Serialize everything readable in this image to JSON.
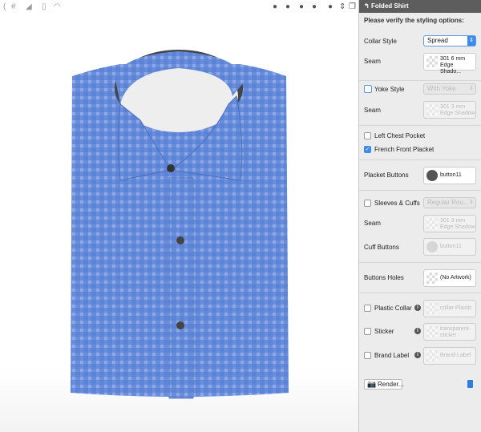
{
  "toolbar": {
    "left_icons": [
      "rotate-icon",
      "grid-icon",
      "plane-icon",
      "ruler-icon",
      "gauge-icon"
    ],
    "right_icons": [
      "head-view-1-icon",
      "head-view-2-icon",
      "head-view-3-icon",
      "head-view-4-icon",
      "head-view-5-icon",
      "stepper-icon",
      "window-icon"
    ]
  },
  "panel": {
    "title": "Folded Shirt",
    "hint": "Please verify the styling options:",
    "collar": {
      "label": "Collar Style",
      "value": "Spread"
    },
    "seam1": {
      "label": "Seam",
      "line1": "301 6 mm",
      "line2": "Edge Shado..."
    },
    "yoke": {
      "label": "Yoke Style",
      "value": "With Yoke",
      "checked": false
    },
    "seam2": {
      "label": "Seam",
      "line1": "301 3 mm",
      "line2": "Edge Shadow"
    },
    "chest_pocket": {
      "label": "Left Chest Pocket",
      "checked": false
    },
    "french_placket": {
      "label": "French Front Placket",
      "checked": true
    },
    "placket_buttons": {
      "label": "Placket Buttons",
      "value": "button11"
    },
    "sleeves": {
      "label": "Sleeves & Cuffs",
      "value": "Regular Rou...",
      "checked": false
    },
    "seam3": {
      "label": "Seam",
      "line1": "301 3 mm",
      "line2": "Edge Shadow"
    },
    "cuff_buttons": {
      "label": "Cuff Buttons",
      "value": "button11"
    },
    "button_holes": {
      "label": "Buttons Holes",
      "value": "(No Artwork)"
    },
    "plastic_collar": {
      "label": "Plastic Collar",
      "value": "collar-Plastic",
      "checked": false
    },
    "sticker": {
      "label": "Sticker",
      "line1": "transparent-",
      "line2": "sticker",
      "checked": false
    },
    "brand_label": {
      "label": "Brand Label",
      "value": "Brand-Label",
      "checked": false
    },
    "render_label": "Render..."
  },
  "colors": {
    "shirt": "#5b83d6",
    "accent": "#3d8be8",
    "header": "#5d5d5d"
  }
}
